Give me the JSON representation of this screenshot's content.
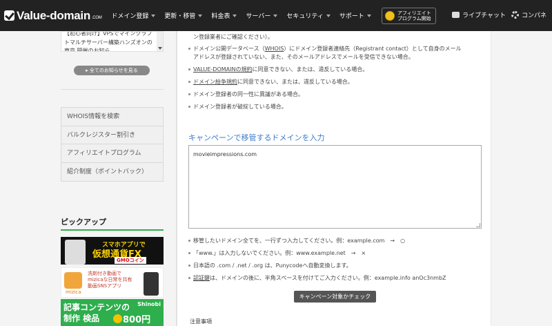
{
  "header": {
    "logo_text": "Value-domain",
    "logo_sub": ".COM",
    "nav": [
      "ドメイン登録",
      "更新・移管",
      "料金表",
      "サーバー",
      "セキュリティ",
      "サポート"
    ],
    "affiliate_line1": "アフィリエイト",
    "affiliate_line2": "プログラム開始",
    "live_chat": "ライブチャット",
    "control_panel": "コンパネ"
  },
  "sidebar": {
    "news_text": "【初心者向け】VPSでマインクラフトマルチサーバー構築ハンズオンの東京 開催のお知ら",
    "all_news": "▸ 全てのお知らせを見る",
    "menu": [
      "WHOIS情報を検索",
      "バルクレジスター割引き",
      "アフィリエイトプログラム",
      "紹介制度（ポイントバック）"
    ],
    "pickup_title": "ピックアップ",
    "banner1": {
      "line1": "スマホアプリで",
      "line2": "仮想通貨FX",
      "line3": "GMOコイン"
    },
    "banner2": {
      "brand": "mizica",
      "text": "洗剤付き動画でmizicaな日常を共有動画SNSアプリ"
    },
    "banner3": {
      "line1": "記事コンテンツの",
      "line2": "制作 検品",
      "price": "800円",
      "brand": "Shinobi"
    }
  },
  "main": {
    "top_partial": "ン登録業者にご確認ください）。",
    "bullets_top": [
      {
        "pre": "ドメイン公開データベース（",
        "u": "WHOIS",
        "post": "）にドメイン登録者連絡先（Registrant contact）として自身のメール"
      },
      {
        "pre": "アドレスが登録されていない、また、そのメールアドレスでメールを受信できない場合。",
        "u": "",
        "post": ""
      },
      {
        "pre": "",
        "u": "VALUE-DOMAINの規約",
        "post": "に同意できない、または、違反している場合。"
      },
      {
        "pre": "",
        "u": "ドメイン紛争規約",
        "post": "に同意できない、または、違反している場合。"
      },
      {
        "pre": "ドメイン登録者の同一性に異議がある場合。",
        "u": "",
        "post": ""
      },
      {
        "pre": "ドメイン登録者が破綻している場合。",
        "u": "",
        "post": ""
      }
    ],
    "section_title": "キャンペーンで移管するドメインを入力",
    "textarea_value": "movieimpressions.com",
    "bullets_bottom": [
      {
        "pre": "移管したいドメイン全てを、一行ずつ入力してください。例：example.com　→　○",
        "u": "",
        "post": ""
      },
      {
        "pre": "「www.」は入力しないでください。例：www.example.net　→　×",
        "u": "",
        "post": ""
      },
      {
        "pre": "日本語の .com / .net / .org は、Punycodeへ自動変換します。",
        "u": "",
        "post": ""
      },
      {
        "pre": "",
        "u": "認証鍵",
        "post": "は、ドメインの後に、半角スペースを付けてご入力ください。例：example.info anOc3nmbZ"
      }
    ],
    "check_button": "キャンペーン対象かチェック",
    "notes_label": "注意事項"
  }
}
